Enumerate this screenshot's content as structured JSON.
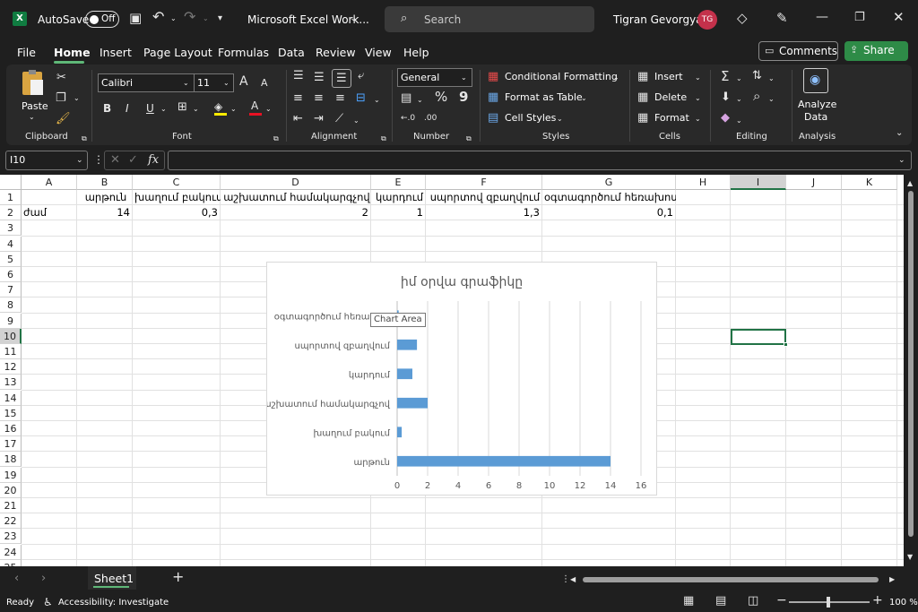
{
  "window": {
    "title": "Microsoft Excel Work...",
    "autosave_label": "AutoSave",
    "autosave_state": "Off",
    "search_placeholder": "Search",
    "user_name": "Tigran Gevorgyan",
    "user_initials": "TG"
  },
  "menu": {
    "items": [
      "File",
      "Home",
      "Insert",
      "Page Layout",
      "Formulas",
      "Data",
      "Review",
      "View",
      "Help"
    ],
    "active": "Home",
    "comments_label": "Comments",
    "share_label": "Share"
  },
  "ribbon": {
    "clipboard": {
      "paste": "Paste",
      "group": "Clipboard"
    },
    "font": {
      "name": "Calibri",
      "size": "11",
      "bold": "B",
      "italic": "I",
      "underline": "U",
      "grow": "A",
      "shrink": "A",
      "group": "Font"
    },
    "alignment": {
      "group": "Alignment"
    },
    "number": {
      "format": "General",
      "percent": "%",
      "comma": "9",
      "group": "Number"
    },
    "styles": {
      "conditional": "Conditional Formatting",
      "table": "Format as Table",
      "cell_styles": "Cell Styles",
      "group": "Styles"
    },
    "cells": {
      "insert": "Insert",
      "delete": "Delete",
      "format": "Format",
      "group": "Cells"
    },
    "editing": {
      "group": "Editing"
    },
    "analysis": {
      "analyze_line1": "Analyze",
      "analyze_line2": "Data",
      "group": "Analysis"
    }
  },
  "formula_bar": {
    "name_box": "I10",
    "fx": "fx",
    "value": ""
  },
  "sheet": {
    "columns": [
      "A",
      "B",
      "C",
      "D",
      "E",
      "F",
      "G",
      "H",
      "I",
      "J",
      "K"
    ],
    "rows": [
      "1",
      "2",
      "3",
      "4",
      "5",
      "6",
      "7",
      "8",
      "9",
      "10",
      "11",
      "12",
      "13",
      "14",
      "15",
      "16",
      "17",
      "18",
      "19",
      "20",
      "21",
      "22",
      "23",
      "24",
      "25"
    ],
    "selected_cell": "I10",
    "row1": [
      "",
      "արթուն",
      "խաղում բակում",
      "աշխատում համակարգչով",
      "կարդում",
      "սպորտով զբաղվում",
      "օգտագործում հեռախոս"
    ],
    "row2": [
      "ժամ",
      "14",
      "0,3",
      "2",
      "1",
      "1,3",
      "0,1"
    ]
  },
  "chart_data": {
    "type": "bar",
    "orientation": "horizontal",
    "title": "իմ օրվա գրաֆիկը",
    "categories": [
      "արթուն",
      "խաղում բակում",
      "աշխատում համակարգչով",
      "կարդում",
      "սպորտով զբաղվում",
      "օգտագործում հեռախոս"
    ],
    "values": [
      14,
      0.3,
      2,
      1,
      1.3,
      0.1
    ],
    "xlim": [
      0,
      16
    ],
    "xticks": [
      "0",
      "2",
      "4",
      "6",
      "8",
      "10",
      "12",
      "14",
      "16"
    ],
    "grid": "vertical",
    "bar_color": "#5b9bd5",
    "tooltip": "Chart Area"
  },
  "tabs": {
    "sheets": [
      "Sheet1"
    ],
    "add": "+"
  },
  "status": {
    "ready": "Ready",
    "accessibility": "Accessibility: Investigate",
    "zoom": "100 %"
  },
  "colors": {
    "accent_green": "#107c41",
    "share_green": "#2e8b47",
    "avatar_red": "#c4314b",
    "bar": "#5b9bd5"
  }
}
